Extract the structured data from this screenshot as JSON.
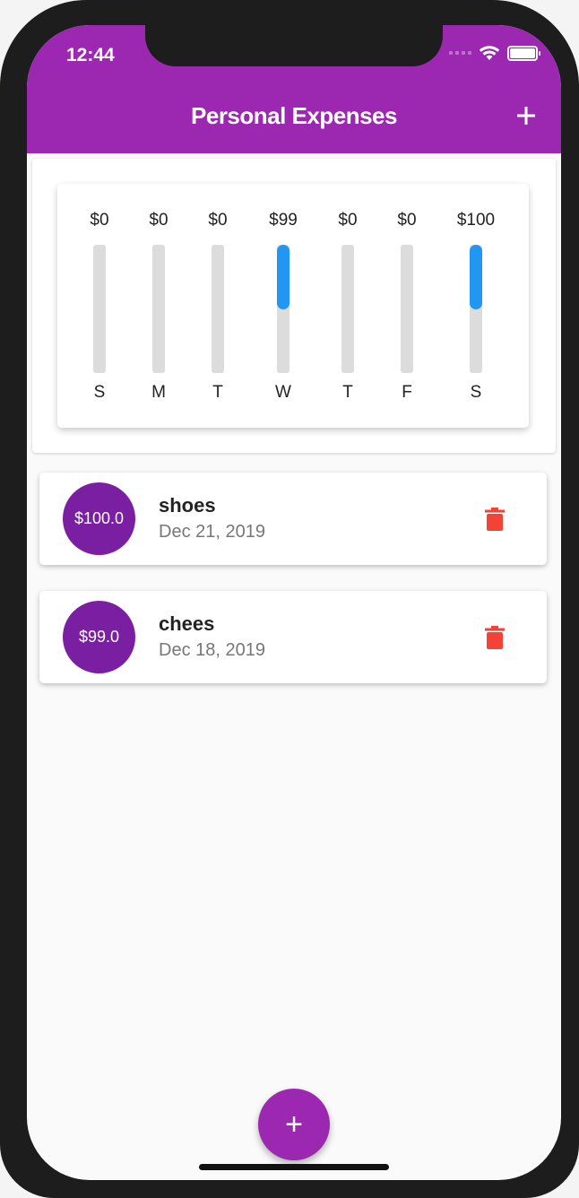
{
  "status_bar": {
    "time": "12:44"
  },
  "app_bar": {
    "title": "Personal Expenses",
    "add_icon": "plus-icon"
  },
  "chart_data": {
    "type": "bar",
    "categories": [
      "S",
      "M",
      "T",
      "W",
      "T",
      "F",
      "S"
    ],
    "amount_labels": [
      "$0",
      "$0",
      "$0",
      "$99",
      "$0",
      "$0",
      "$100"
    ],
    "values": [
      0,
      0,
      0,
      99,
      0,
      0,
      100
    ],
    "fill_fractions": [
      0,
      0,
      0,
      0.5,
      0,
      0,
      0.5
    ],
    "bar_color": "#2196f3",
    "track_color": "#dcdcdc"
  },
  "transactions": [
    {
      "amount": "$100.0",
      "title": "shoes",
      "date": "Dec 21, 2019",
      "delete_icon": "trash-icon"
    },
    {
      "amount": "$99.0",
      "title": "chees",
      "date": "Dec 18, 2019",
      "delete_icon": "trash-icon"
    }
  ],
  "fab": {
    "icon": "plus-icon",
    "label": "+"
  },
  "colors": {
    "primary": "#9c27b0",
    "avatar": "#7b1fa2",
    "delete": "#f44336"
  }
}
